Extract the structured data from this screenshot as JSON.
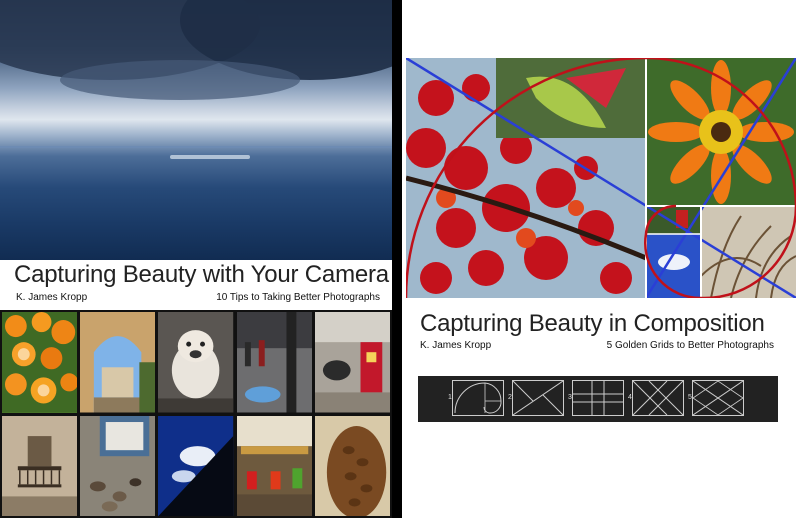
{
  "left_cover": {
    "title": "Capturing Beauty with Your Camera",
    "author": "K. James Kropp",
    "subtitle": "10 Tips to Taking Better Photographs"
  },
  "right_cover": {
    "title": "Capturing Beauty in Composition",
    "author": "K. James Kropp",
    "subtitle": "5 Golden Grids to Better Photographs",
    "grids": [
      {
        "number": "1",
        "icon": "golden-spiral-grid-icon"
      },
      {
        "number": "2",
        "icon": "golden-triangle-grid-icon"
      },
      {
        "number": "3",
        "icon": "phi-grid-icon"
      },
      {
        "number": "4",
        "icon": "diagonal-grid-icon"
      },
      {
        "number": "5",
        "icon": "cross-diagonal-grid-icon"
      }
    ]
  },
  "colors": {
    "background": "#000000",
    "cover": "#ffffff",
    "strip": "#222222",
    "grid_line": "#2a3fd6",
    "spiral": "#c0111a"
  }
}
